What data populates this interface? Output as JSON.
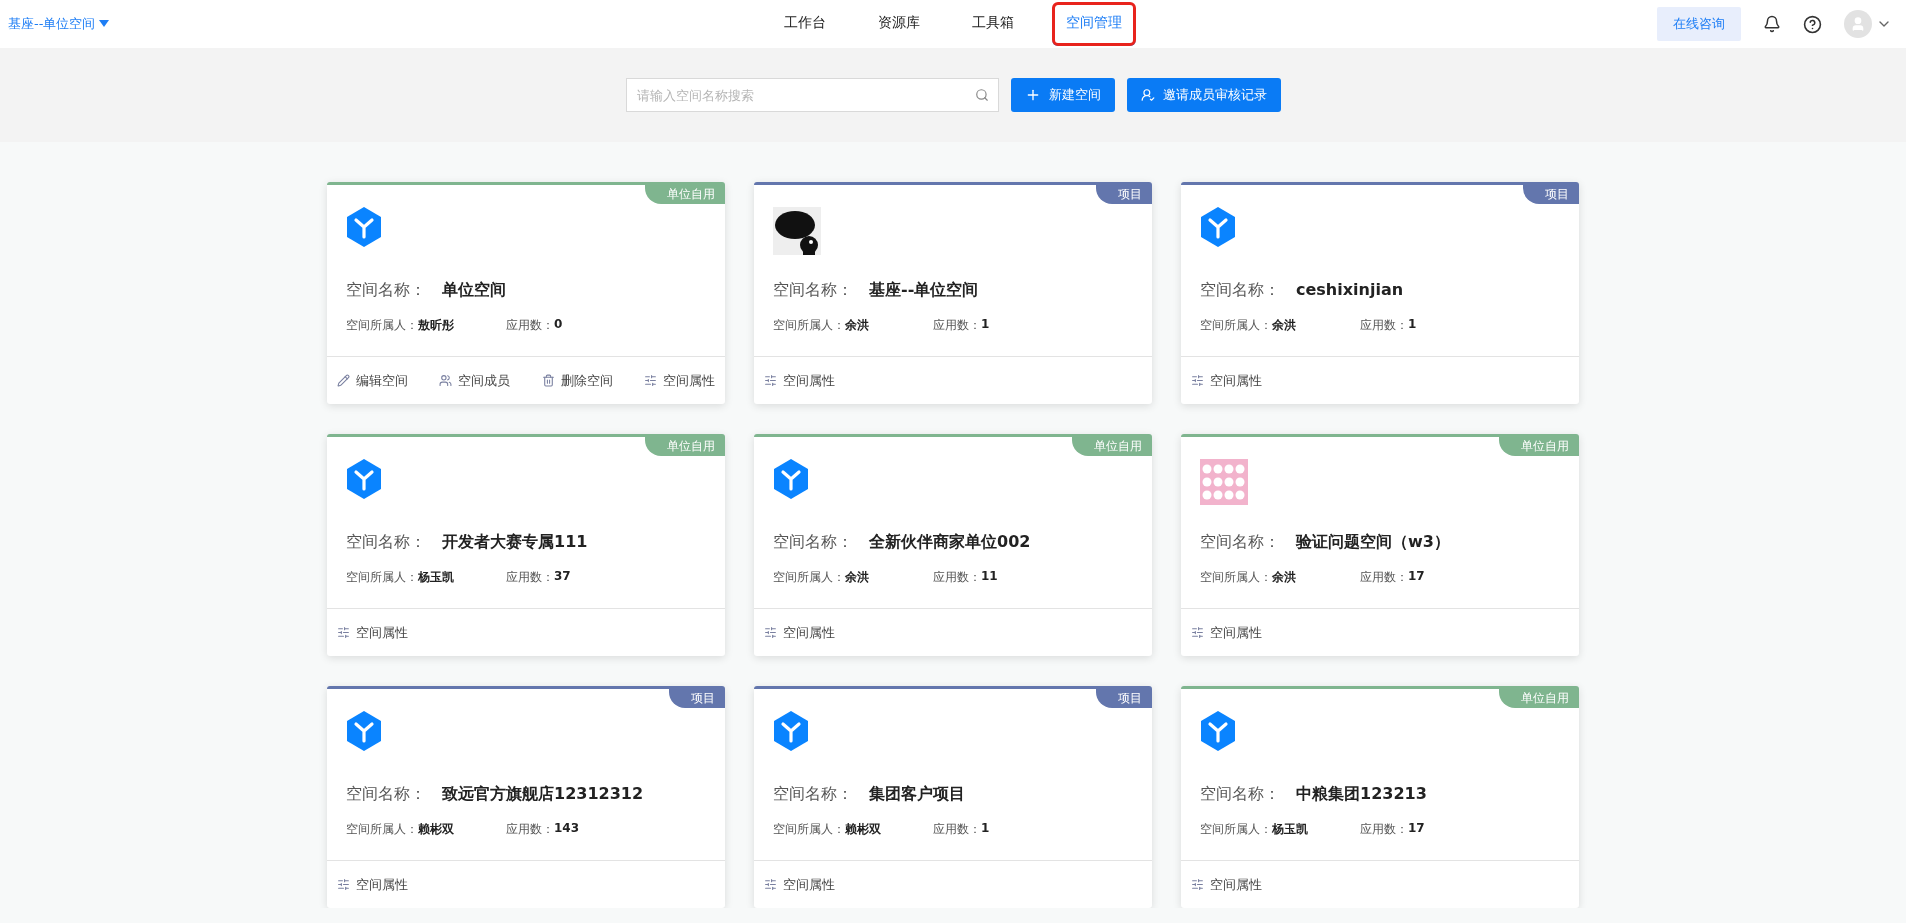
{
  "header": {
    "space_switcher": "基座--单位空间",
    "nav": [
      {
        "label": "工作台",
        "selected": false,
        "annotated": false
      },
      {
        "label": "资源库",
        "selected": false,
        "annotated": false
      },
      {
        "label": "工具箱",
        "selected": false,
        "annotated": false
      },
      {
        "label": "空间管理",
        "selected": true,
        "annotated": true
      }
    ],
    "consult_button": "在线咨询"
  },
  "toolbar": {
    "search": {
      "placeholder": "请输入空间名称搜索"
    },
    "buttons": [
      {
        "kind": "add",
        "label": "新建空间"
      },
      {
        "kind": "invite",
        "label": "邀请成员审核记录"
      }
    ]
  },
  "cards": [
    {
      "badge": {
        "kind": "unit",
        "label": "单位自用"
      },
      "logo": {
        "kind": "hex"
      },
      "name_label": "空间名称：",
      "name": "单位空间",
      "owner_label": "空间所属人：",
      "owner": "敖昕彤",
      "apps_label": "应用数：",
      "apps": "0",
      "actions": [
        {
          "kind": "edit",
          "label": "编辑空间"
        },
        {
          "kind": "members",
          "label": "空间成员"
        },
        {
          "kind": "delete",
          "label": "删除空间"
        },
        {
          "kind": "props",
          "label": "空间属性"
        }
      ]
    },
    {
      "badge": {
        "kind": "project",
        "label": "项目"
      },
      "logo": {
        "kind": "picture"
      },
      "name_label": "空间名称：",
      "name": "基座--单位空间",
      "owner_label": "空间所属人：",
      "owner": "余洪",
      "apps_label": "应用数：",
      "apps": "1",
      "actions": [
        {
          "kind": "props",
          "label": "空间属性"
        }
      ]
    },
    {
      "badge": {
        "kind": "project",
        "label": "项目"
      },
      "logo": {
        "kind": "hex"
      },
      "name_label": "空间名称：",
      "name": "ceshixinjian",
      "owner_label": "空间所属人：",
      "owner": "余洪",
      "apps_label": "应用数：",
      "apps": "1",
      "actions": [
        {
          "kind": "props",
          "label": "空间属性"
        }
      ]
    },
    {
      "badge": {
        "kind": "unit",
        "label": "单位自用"
      },
      "logo": {
        "kind": "hex"
      },
      "name_label": "空间名称：",
      "name": "开发者大赛专属111",
      "owner_label": "空间所属人：",
      "owner": "杨玉凯",
      "apps_label": "应用数：",
      "apps": "37",
      "actions": [
        {
          "kind": "props",
          "label": "空间属性"
        }
      ]
    },
    {
      "badge": {
        "kind": "unit",
        "label": "单位自用"
      },
      "logo": {
        "kind": "hex"
      },
      "name_label": "空间名称：",
      "name": "全新伙伴商家单位002",
      "owner_label": "空间所属人：",
      "owner": "余洪",
      "apps_label": "应用数：",
      "apps": "11",
      "actions": [
        {
          "kind": "props",
          "label": "空间属性"
        }
      ]
    },
    {
      "badge": {
        "kind": "unit",
        "label": "单位自用"
      },
      "logo": {
        "kind": "picture"
      },
      "name_label": "空间名称：",
      "name": "验证问题空间（w3）",
      "owner_label": "空间所属人：",
      "owner": "余洪",
      "apps_label": "应用数：",
      "apps": "17",
      "actions": [
        {
          "kind": "props",
          "label": "空间属性"
        }
      ]
    },
    {
      "badge": {
        "kind": "project",
        "label": "项目"
      },
      "logo": {
        "kind": "hex"
      },
      "name_label": "空间名称：",
      "name": "致远官方旗舰店12312312",
      "owner_label": "空间所属人：",
      "owner": "赖彬双",
      "apps_label": "应用数：",
      "apps": "143",
      "actions": [
        {
          "kind": "props",
          "label": "空间属性"
        }
      ]
    },
    {
      "badge": {
        "kind": "project",
        "label": "项目"
      },
      "logo": {
        "kind": "hex"
      },
      "name_label": "空间名称：",
      "name": "集团客户项目",
      "owner_label": "空间所属人：",
      "owner": "赖彬双",
      "apps_label": "应用数：",
      "apps": "1",
      "actions": [
        {
          "kind": "props",
          "label": "空间属性"
        }
      ]
    },
    {
      "badge": {
        "kind": "unit",
        "label": "单位自用"
      },
      "logo": {
        "kind": "hex"
      },
      "name_label": "空间名称：",
      "name": "中粮集团123213",
      "owner_label": "空间所属人：",
      "owner": "杨玉凯",
      "apps_label": "应用数：",
      "apps": "17",
      "actions": [
        {
          "kind": "props",
          "label": "空间属性"
        }
      ]
    }
  ]
}
